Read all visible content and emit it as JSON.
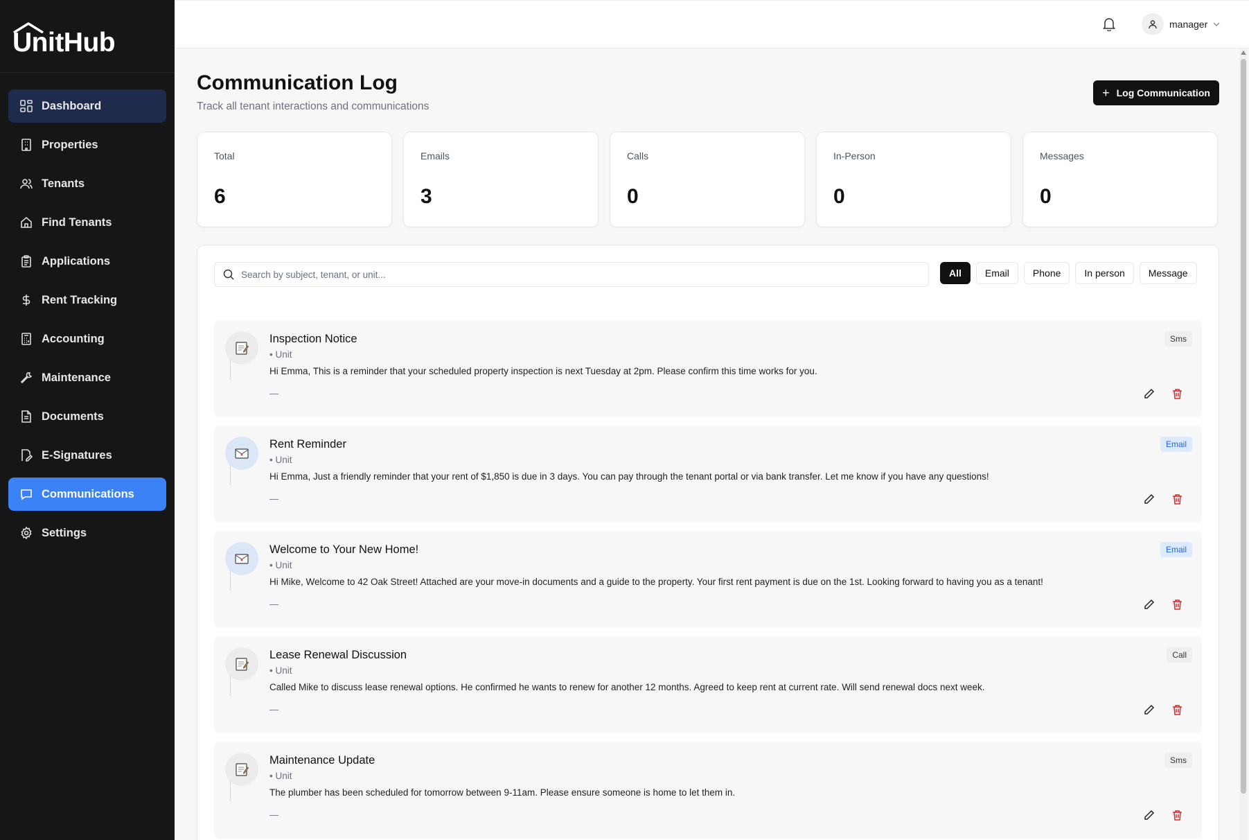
{
  "app": {
    "name": "UnitHub"
  },
  "sidebar": {
    "items": [
      {
        "label": "Dashboard",
        "icon": "grid-icon"
      },
      {
        "label": "Properties",
        "icon": "building-icon"
      },
      {
        "label": "Tenants",
        "icon": "users-icon"
      },
      {
        "label": "Find Tenants",
        "icon": "home-icon"
      },
      {
        "label": "Applications",
        "icon": "clipboard-icon"
      },
      {
        "label": "Rent Tracking",
        "icon": "dollar-icon"
      },
      {
        "label": "Accounting",
        "icon": "calculator-icon"
      },
      {
        "label": "Maintenance",
        "icon": "wrench-icon"
      },
      {
        "label": "Documents",
        "icon": "file-icon"
      },
      {
        "label": "E-Signatures",
        "icon": "signature-icon"
      },
      {
        "label": "Communications",
        "icon": "message-icon"
      },
      {
        "label": "Settings",
        "icon": "gear-icon"
      }
    ]
  },
  "topbar": {
    "user": "manager"
  },
  "header": {
    "title": "Communication Log",
    "subtitle": "Track all tenant interactions and communications",
    "log_button": "Log Communication"
  },
  "stats": [
    {
      "label": "Total",
      "value": "6"
    },
    {
      "label": "Emails",
      "value": "3"
    },
    {
      "label": "Calls",
      "value": "0"
    },
    {
      "label": "In-Person",
      "value": "0"
    },
    {
      "label": "Messages",
      "value": "0"
    }
  ],
  "search": {
    "placeholder": "Search by subject, tenant, or unit..."
  },
  "filters": [
    "All",
    "Email",
    "Phone",
    "In person",
    "Message"
  ],
  "communications": [
    {
      "subject": "Inspection Notice",
      "unit": "• Unit",
      "body": "Hi Emma, This is a reminder that your scheduled property inspection is next Tuesday at 2pm. Please confirm this time works for you.",
      "dash": "—",
      "type": "Sms"
    },
    {
      "subject": "Rent Reminder",
      "unit": "• Unit",
      "body": "Hi Emma, Just a friendly reminder that your rent of $1,850 is due in 3 days. You can pay through the tenant portal or via bank transfer. Let me know if you have any questions!",
      "dash": "—",
      "type": "Email"
    },
    {
      "subject": "Welcome to Your New Home!",
      "unit": "• Unit",
      "body": "Hi Mike, Welcome to 42 Oak Street! Attached are your move-in documents and a guide to the property. Your first rent payment is due on the 1st. Looking forward to having you as a tenant!",
      "dash": "—",
      "type": "Email"
    },
    {
      "subject": "Lease Renewal Discussion",
      "unit": "• Unit",
      "body": "Called Mike to discuss lease renewal options. He confirmed he wants to renew for another 12 months. Agreed to keep rent at current rate. Will send renewal docs next week.",
      "dash": "—",
      "type": "Call"
    },
    {
      "subject": "Maintenance Update",
      "unit": "• Unit",
      "body": "The plumber has been scheduled for tomorrow between 9-11am. Please ensure someone is home to let them in.",
      "dash": "—",
      "type": "Sms"
    }
  ],
  "colors": {
    "sidebar_bg": "#161616",
    "active_blue": "#3b82f6",
    "dashboard_highlight": "#1e2b4d",
    "delete_red": "#dc2626",
    "email_badge": "#2563eb"
  }
}
